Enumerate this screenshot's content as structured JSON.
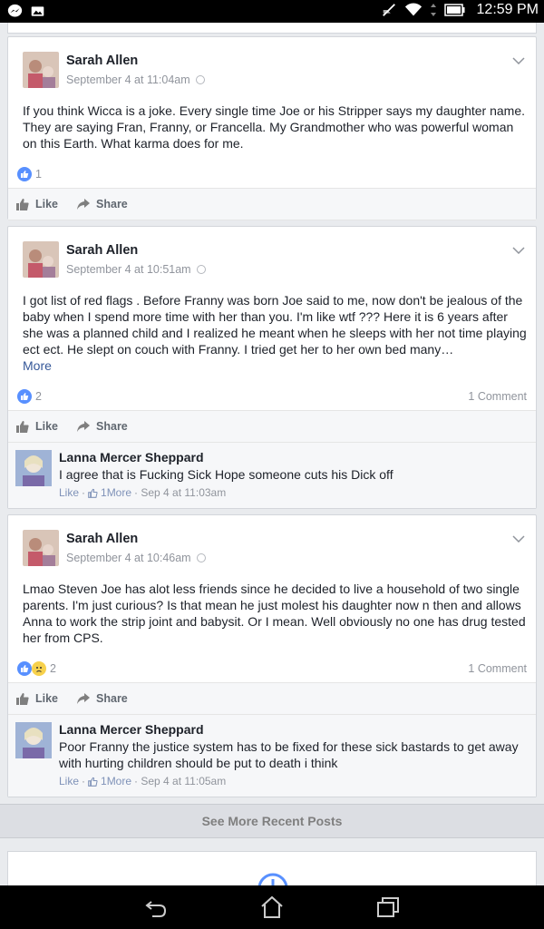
{
  "status_bar": {
    "time": "12:59 PM",
    "icons": [
      "messenger-icon",
      "gallery-icon",
      "mute-icon",
      "wifi-icon",
      "battery-icon"
    ]
  },
  "posts": [
    {
      "author": "Sarah Allen",
      "timestamp": "September 4 at 11:04am",
      "text": "If you think Wicca is a joke. Every single time Joe or his Stripper says my daughter name. They are saying Fran, Franny, or Francella. My Grandmother who was powerful woman on this Earth. What karma does for me.",
      "reaction_count": "1",
      "like_label": "Like",
      "share_label": "Share"
    },
    {
      "author": "Sarah Allen",
      "timestamp": "September 4 at 10:51am",
      "text": "I got list of red flags . Before Franny was born Joe said to me, now don't be jealous of the baby when I spend more time with her than you. I'm like wtf ??? Here it is 6 years after she was a planned child and I realized he meant when he sleeps with her not time playing ect ect. He slept on couch with Franny. I tried get her to her own bed many…",
      "more_label": "More",
      "reaction_count": "2",
      "comment_count": "1 Comment",
      "like_label": "Like",
      "share_label": "Share",
      "comment": {
        "author": "Lanna Mercer Sheppard",
        "text": "I agree that is Fucking Sick Hope someone cuts his Dick off",
        "like_label": "Like",
        "more_label": "1More",
        "time": "· Sep 4 at 11:03am"
      }
    },
    {
      "author": "Sarah Allen",
      "timestamp": "September 4 at 10:46am",
      "text": "Lmao Steven Joe has alot less friends since he decided to live a household of two single parents. I'm just curious? Is that mean he just molest his daughter now n then and allows Anna to work the strip joint and babysit. Or I mean. Well obviously no one has drug tested her from CPS.",
      "reaction_count": "2",
      "comment_count": "1 Comment",
      "like_label": "Like",
      "share_label": "Share",
      "comment": {
        "author": "Lanna Mercer Sheppard",
        "text": "Poor Franny the justice system has to be fixed for these sick bastards to get away with hurting children should be put to death i think",
        "like_label": "Like",
        "more_label": "1More",
        "time": "· Sep 4 at 11:05am"
      }
    }
  ],
  "see_more_label": "See More Recent Posts",
  "colors": {
    "like_blue": "#5890ff",
    "link_blue": "#365899",
    "meta_gray": "#90949c",
    "background": "#e9ebee"
  }
}
